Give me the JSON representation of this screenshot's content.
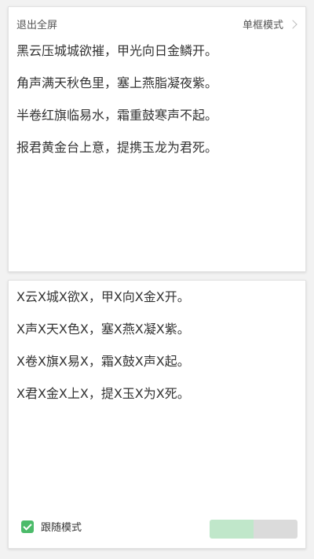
{
  "header": {
    "exit_label": "退出全屏",
    "mode_label": "单框模式"
  },
  "poem_full": [
    "黑云压城城欲摧，甲光向日金鳞开。",
    "角声满天秋色里，塞上燕脂凝夜紫。",
    "半卷红旗临易水，霜重鼓寒声不起。",
    "报君黄金台上意，提携玉龙为君死。"
  ],
  "poem_masked": [
    "X云X城X欲X，甲X向X金X开。",
    "X声X天X色X，塞X燕X凝X紫。",
    "X卷X旗X易X，霜X鼓X声X起。",
    "X君X金X上X，提X玉X为X死。"
  ],
  "footer": {
    "follow_label": "跟随模式",
    "follow_checked": true
  },
  "colors": {
    "accent": "#4cbb6a"
  }
}
